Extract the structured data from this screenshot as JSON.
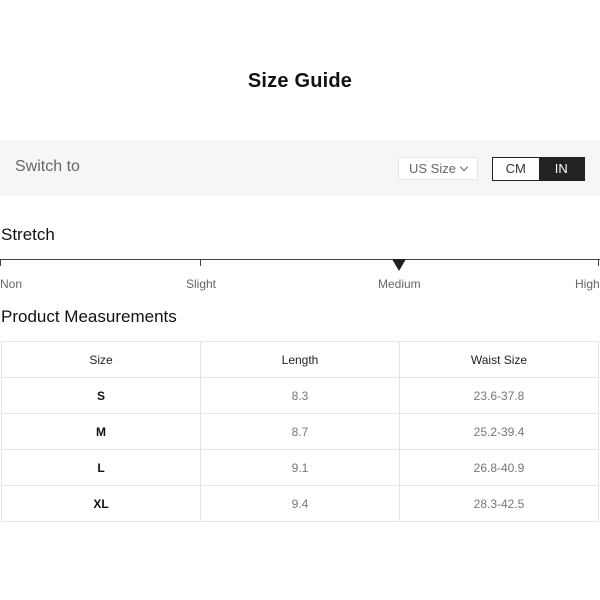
{
  "title": "Size Guide",
  "switch_bar": {
    "label": "Switch to",
    "size_select": "US Size",
    "units": [
      "CM",
      "IN"
    ],
    "active_unit": "IN"
  },
  "stretch": {
    "heading": "Stretch",
    "levels": [
      "Non",
      "Slight",
      "Medium",
      "High"
    ],
    "selected": "Medium"
  },
  "measurements": {
    "heading": "Product Measurements",
    "columns": [
      "Size",
      "Length",
      "Waist Size"
    ],
    "rows": [
      [
        "S",
        "8.3",
        "23.6-37.8"
      ],
      [
        "M",
        "8.7",
        "25.2-39.4"
      ],
      [
        "L",
        "9.1",
        "26.8-40.9"
      ],
      [
        "XL",
        "9.4",
        "28.3-42.5"
      ]
    ]
  },
  "colors": {
    "bar_background": "#f6f6f6",
    "active_toggle": "#222222",
    "border": "#e5e5e5"
  },
  "icons": {
    "select_chevron": "chevron-down-icon",
    "stretch_marker": "triangle-down-icon"
  }
}
